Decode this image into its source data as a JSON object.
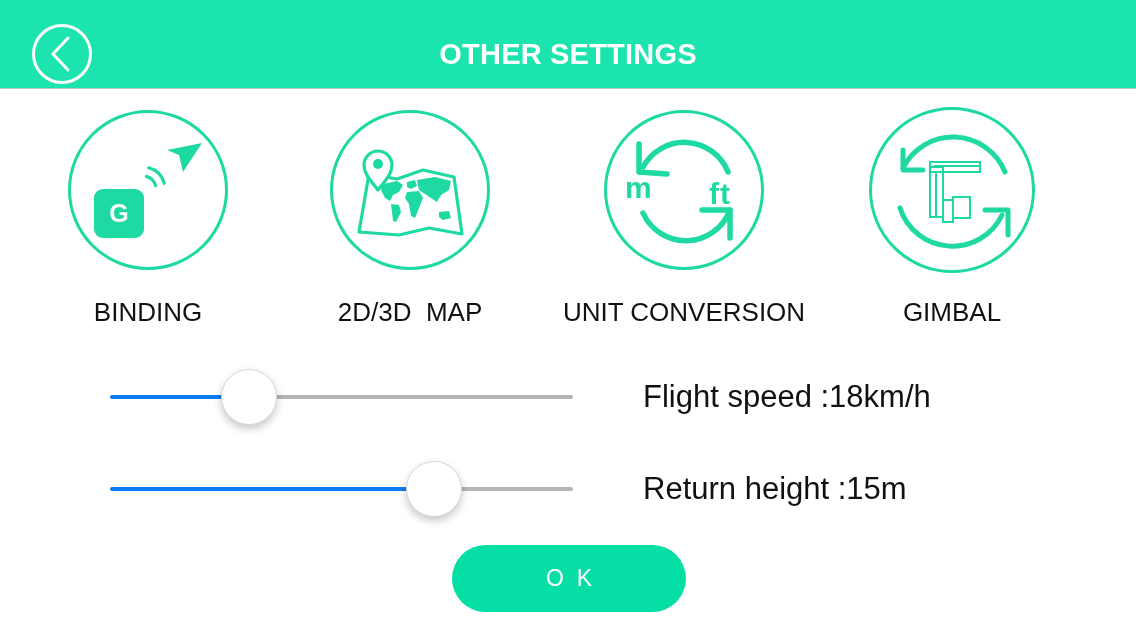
{
  "header": {
    "title": "OTHER SETTINGS"
  },
  "options": [
    {
      "kind": "binding",
      "label": "BINDING",
      "badge": "G"
    },
    {
      "kind": "map",
      "label": "2D/3D  MAP"
    },
    {
      "kind": "units",
      "label": "UNIT CONVERSION",
      "unit_from": "m",
      "unit_to": "ft"
    },
    {
      "kind": "gimbal",
      "label": "GIMBAL"
    }
  ],
  "sliders": [
    {
      "level": 0.3,
      "reading": "Flight speed :18km/h"
    },
    {
      "level": 0.7,
      "reading": "Return height :15m"
    }
  ],
  "ok_button": {
    "label": "OK"
  }
}
